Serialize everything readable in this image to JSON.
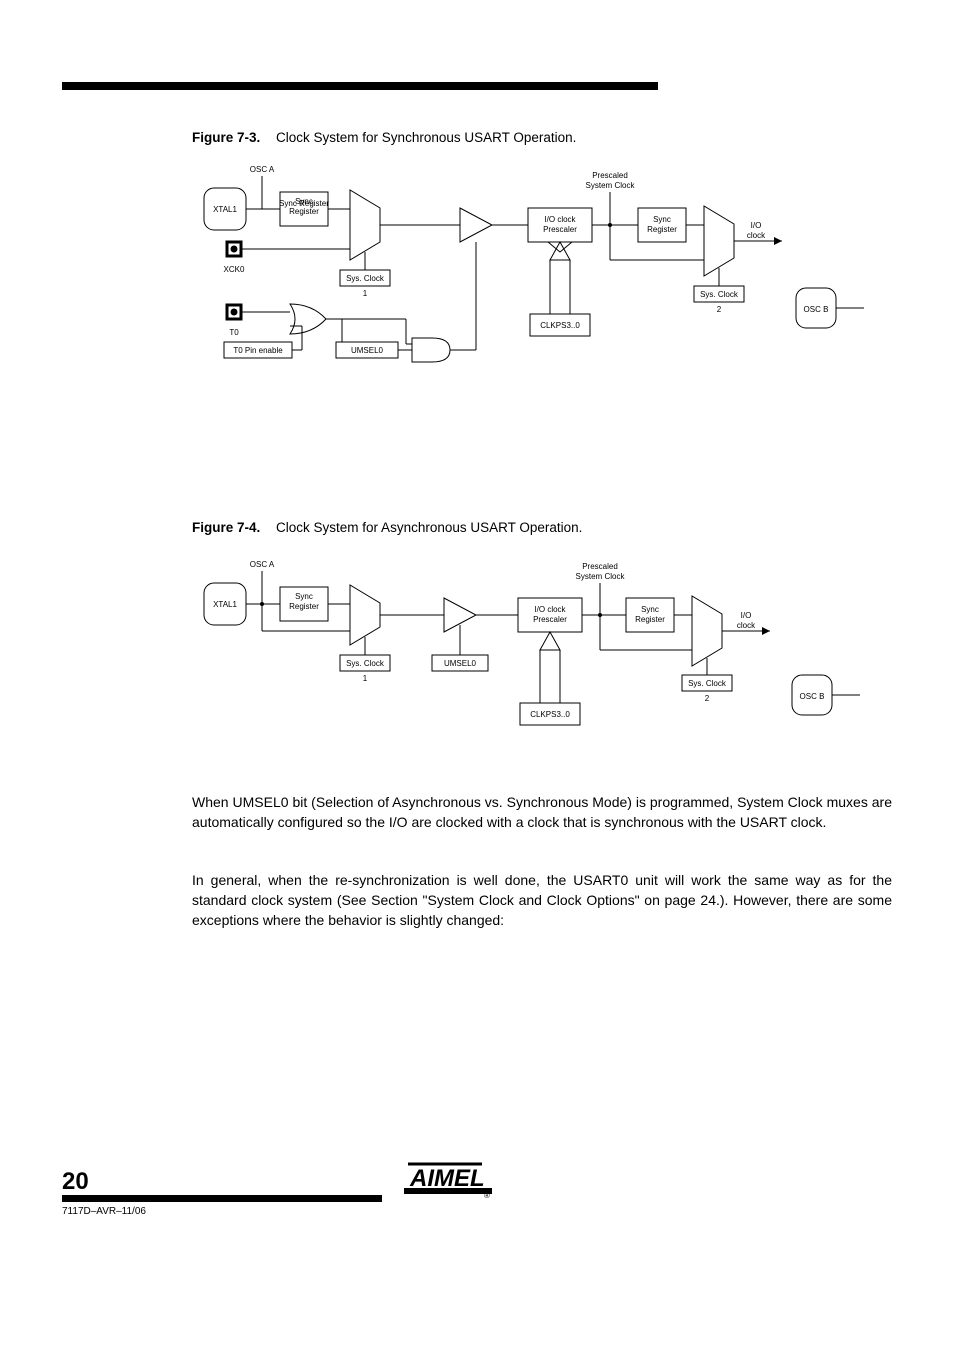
{
  "fig1": {
    "caption_strong": "Figure 7-3.",
    "caption_rest": "Clock System for Synchronous USART Operation.",
    "xtal1": "XTAL1",
    "osca": "OSC A",
    "oscb": "OSC B",
    "pin_xck": "XCK0",
    "pin_t0": "T0",
    "t0pinen": "T0 Pin enable",
    "sync_reg": "Sync\nRegister",
    "sysclk1": "Sys. Clock\n1",
    "umsel0": "UMSEL0",
    "sysclk2": "Sys. Clock\n2",
    "io_clkprescaler": "I/O clock\nPrescaler",
    "prescaled_clock": "Prescaled\nSystem Clock",
    "sync_reg2": "Sync\nRegister",
    "io_clock_out": "I/O\nclock",
    "clkps": "CLKPS3..0"
  },
  "fig2": {
    "caption_strong": "Figure 7-4.",
    "caption_rest": "Clock System for Asynchronous USART Operation.",
    "xtal1": "XTAL1",
    "osca": "OSC A",
    "oscb": "OSC B",
    "sync_reg": "Sync\nRegister",
    "sysclk1": "Sys. Clock\n1",
    "umsel0": "UMSEL0",
    "sysclk2": "Sys. Clock\n2",
    "io_clkprescaler": "I/O clock\nPrescaler",
    "prescaled_clock": "Prescaled\nSystem Clock",
    "sync_reg2": "Sync\nRegister",
    "io_clock_out": "I/O\nclock",
    "clkps": "CLKPS3..0"
  },
  "body": {
    "p1": "When UMSEL0 bit (Selection of Asynchronous vs. Synchronous Mode) is programmed, System Clock muxes are automatically configured so the I/O are clocked with a clock that is synchronous with the USART clock.",
    "p2": "In general, when the re-synchronization is well done, the USART0 unit will work the same way as for the standard clock system (See Section \"System Clock and Clock Options\" on page 24.). However, there are some exceptions where the behavior is slightly changed:"
  },
  "footer": {
    "page": "20",
    "docid": "7117D–AVR–11/06"
  }
}
